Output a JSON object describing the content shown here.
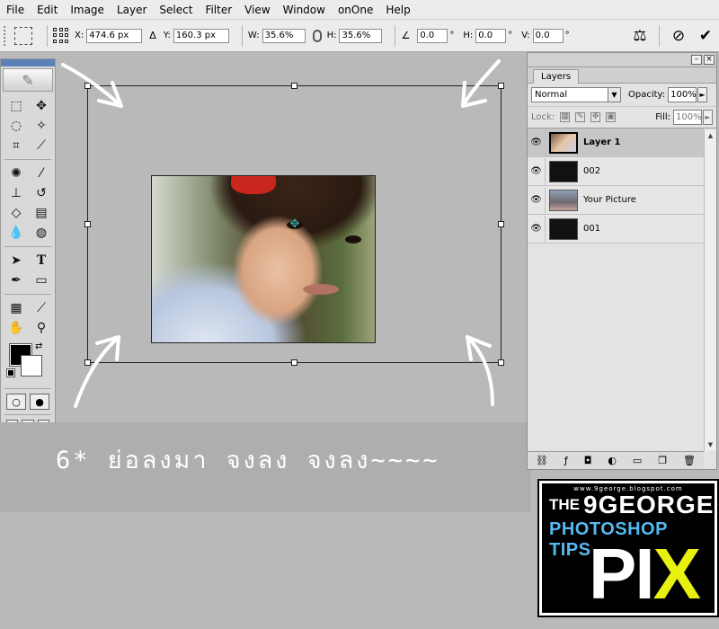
{
  "menu": [
    "File",
    "Edit",
    "Image",
    "Layer",
    "Select",
    "Filter",
    "View",
    "Window",
    "onOne",
    "Help"
  ],
  "options": {
    "x_label": "X:",
    "x_value": "474.6 px",
    "delta_icon": "delta-icon",
    "y_label": "Y:",
    "y_value": "160.3 px",
    "w_label": "W:",
    "w_value": "35.6%",
    "h_label": "H:",
    "h_value": "35.6%",
    "angle_value": "0.0",
    "hskew_label": "H:",
    "hskew_value": "0.0",
    "vskew_label": "V:",
    "vskew_value": "0.0",
    "degree_sign": "°"
  },
  "canvas": {
    "caption": "6* ย่อลงมา จงลง จงลง~~~~"
  },
  "layers_panel": {
    "tab": "Layers",
    "blend_mode": "Normal",
    "opacity_label": "Opacity:",
    "opacity_value": "100%",
    "lock_label": "Lock:",
    "fill_label": "Fill:",
    "fill_value": "100%",
    "layers": [
      {
        "name": "Layer 1",
        "active": true
      },
      {
        "name": "002",
        "active": false
      },
      {
        "name": "Your Picture",
        "active": false
      },
      {
        "name": "001",
        "active": false
      }
    ]
  },
  "logo": {
    "url": "www.9george.blogspot.com",
    "the": "THE",
    "brand": "9GEORGE",
    "subtitle": "PHOTOSHOP TIPS",
    "pi": "PI",
    "x": "X"
  }
}
